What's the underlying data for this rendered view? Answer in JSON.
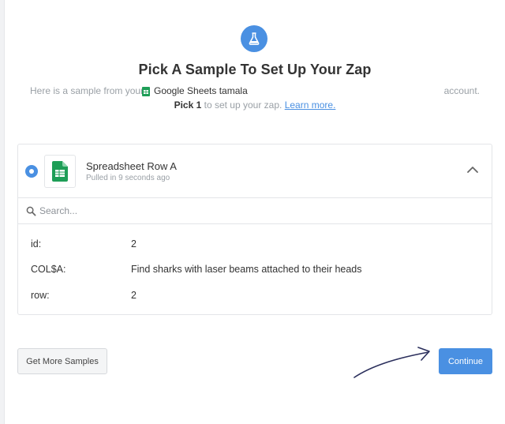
{
  "header": {
    "title": "Pick A Sample To Set Up Your Zap",
    "intro_prefix": "Here is a sample from your",
    "app_account": "Google Sheets tamala",
    "intro_suffix": "account.",
    "pick_count": "Pick 1",
    "pick_rest": "to set up your zap.",
    "learn_more": "Learn more."
  },
  "sample": {
    "name": "Spreadsheet Row A",
    "meta": "Pulled in 9 seconds ago",
    "selected": true
  },
  "search": {
    "placeholder": "Search..."
  },
  "fields": [
    {
      "key": "id:",
      "value": "2"
    },
    {
      "key": "COL$A:",
      "value": "Find sharks with laser beams attached to their heads"
    },
    {
      "key": "row:",
      "value": "2"
    }
  ],
  "buttons": {
    "get_more": "Get More Samples",
    "continue": "Continue"
  },
  "colors": {
    "accent": "#4a90e2",
    "sheets_green": "#1e9e57"
  },
  "icons": [
    "flask-icon",
    "google-sheets-icon",
    "search-icon",
    "chevron-up-icon",
    "arrow-annotation"
  ]
}
